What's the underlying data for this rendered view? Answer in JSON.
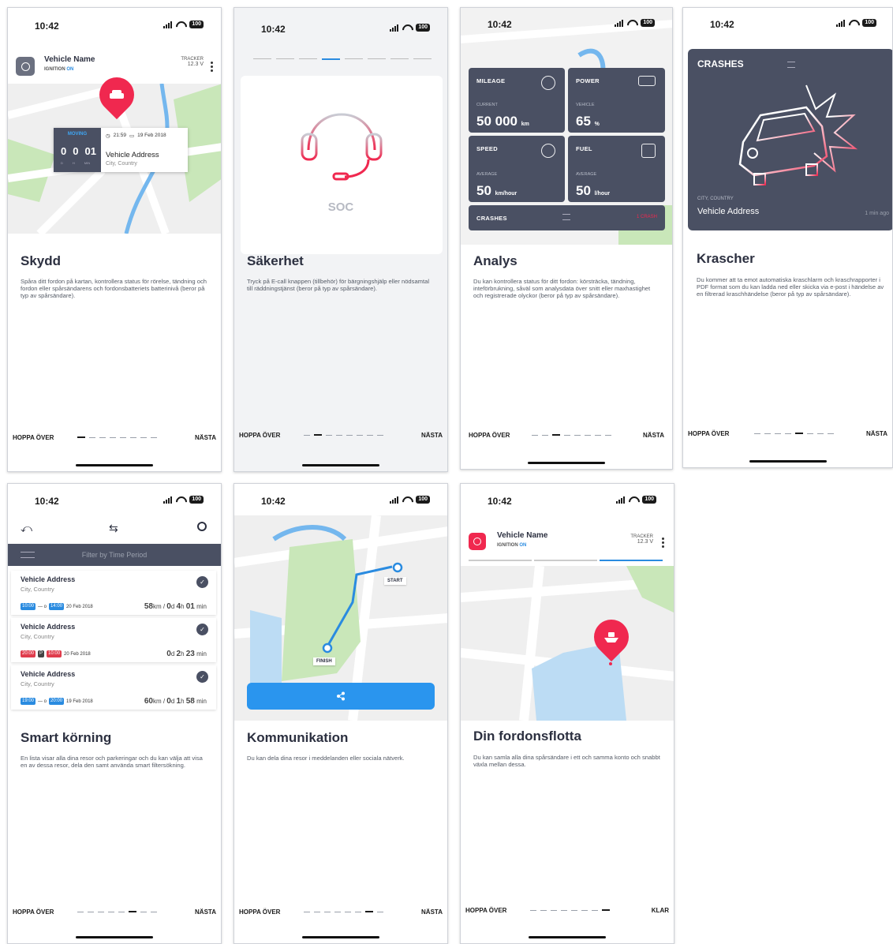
{
  "status": {
    "time": "10:42",
    "battery": "100"
  },
  "nav": {
    "skip": "HOPPA ÖVER",
    "next": "NÄSTA",
    "done": "KLAR"
  },
  "s1": {
    "vehicle_name": "Vehicle Name",
    "ignition_label": "IGNITION",
    "ignition_state": "ON",
    "tracker_label": "TRACKER",
    "voltage": "12.3 V",
    "moving": "MOVING",
    "time": "21:59",
    "date": "19 Feb 2018",
    "counter": [
      "0",
      "0",
      "01"
    ],
    "counter_units": [
      "D",
      "H",
      "MIN"
    ],
    "address": "Vehicle Address",
    "city": "City, Country",
    "title": "Skydd",
    "desc": "Spåra ditt fordon på kartan, kontrollera status för rörelse, tändning och fordon eller spårsändarens och fordonsbatteriets batterinivå (beror på typ av spårsändare)."
  },
  "s2": {
    "soc": "SOC",
    "title": "Säkerhet",
    "desc": "Tryck på E-call knappen (tillbehör) för bärgningshjälp eller nödsamtal till räddningstjänst (beror på typ av spårsändare)."
  },
  "s3": {
    "cards": [
      {
        "label": "MILEAGE",
        "sub": "CURRENT",
        "value": "50 000",
        "unit": "km"
      },
      {
        "label": "POWER",
        "sub": "VEHICLE",
        "value": "65",
        "unit": "%"
      },
      {
        "label": "SPEED",
        "sub": "AVERAGE",
        "value": "50",
        "unit": "km/hour"
      },
      {
        "label": "FUEL",
        "sub": "AVERAGE",
        "value": "50",
        "unit": "l/hour"
      }
    ],
    "crashes": "CRASHES",
    "crash_count": "1 CRASH",
    "title": "Analys",
    "desc": "Du kan kontrollera status för ditt fordon: körsträcka, tändning, inteförbrukning, såväl som analysdata över snitt eller maxhastighet och registrerade olyckor (beror på typ av spårsändare)."
  },
  "s4": {
    "header": "CRASHES",
    "city": "CITY, COUNTRY",
    "address": "Vehicle Address",
    "ago": "1 min ago",
    "title": "Krascher",
    "desc": "Du kommer att ta emot automatiska kraschlarm och kraschrapporter i PDF format som du kan ladda ned eller skicka via e-post i händelse av en filtrerad kraschhändelse (beror på typ av spårsändare)."
  },
  "s5": {
    "filter": "Filter by Time Period",
    "trips": [
      {
        "address": "Vehicle Address",
        "city": "City, Country",
        "from": "10:00",
        "mid": "—  o",
        "to": "14:00",
        "date": "20 Feb 2018",
        "dist": "58",
        "dist_unit": "km / ",
        "days": "0",
        "d_unit": "d ",
        "hours": "4",
        "h_unit": "h ",
        "mins": "01",
        "m_unit": " min"
      },
      {
        "address": "Vehicle Address",
        "city": "City, Country",
        "from": "20:00",
        "mid": "P",
        "to": "10:00",
        "date": "20 Feb 2018",
        "dist": "",
        "dist_unit": "",
        "days": "0",
        "d_unit": "d ",
        "hours": "2",
        "h_unit": "h ",
        "mins": "23",
        "m_unit": " min"
      },
      {
        "address": "Vehicle Address",
        "city": "City, Country",
        "from": "19:00",
        "mid": "—  o",
        "to": "20:00",
        "date": "19 Feb 2018",
        "dist": "60",
        "dist_unit": "km / ",
        "days": "0",
        "d_unit": "d ",
        "hours": "1",
        "h_unit": "h ",
        "mins": "58",
        "m_unit": " min"
      }
    ],
    "title": "Smart körning",
    "desc": "En lista visar alla dina resor och parkeringar och du kan välja att visa en av dessa resor, dela den samt använda smart filtersökning."
  },
  "s6": {
    "start": "START",
    "finish": "FINISH",
    "title": "Kommunikation",
    "desc": "Du kan dela dina resor i meddelanden eller sociala nätverk."
  },
  "s7": {
    "vehicle_name": "Vehicle Name",
    "ignition_label": "IGNITION",
    "ignition_state": "ON",
    "tracker_label": "TRACKER",
    "voltage": "12.3 V",
    "title": "Din fordonsflotta",
    "desc": "Du kan samla alla dina spårsändare i ett och samma konto och snabbt växla mellan dessa."
  }
}
